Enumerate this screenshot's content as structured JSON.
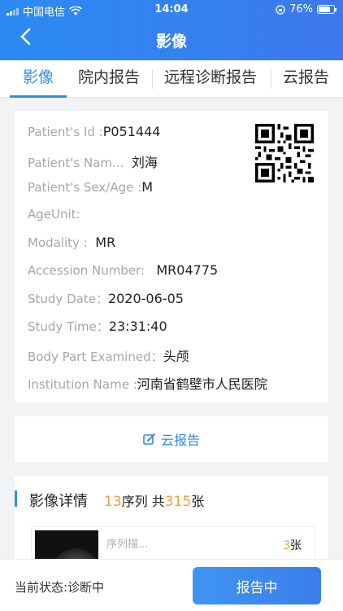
{
  "status_bar": {
    "carrier": "中国电信",
    "time": "14:04",
    "battery": "76%"
  },
  "nav": {
    "title": "影像",
    "back_icon": "chevron-left-icon"
  },
  "tabs": [
    {
      "label": "影像",
      "active": true
    },
    {
      "label": "院内报告",
      "active": false
    },
    {
      "label": "远程诊断报告",
      "active": false
    },
    {
      "label": "云报告",
      "active": false
    }
  ],
  "patient": {
    "id_label": "Patient's Id :",
    "id_value": "P051444",
    "name_label": "Patient's Nam...",
    "name_value": "刘海",
    "sex_label": "Patient's Sex/Age :",
    "sex_value": "M",
    "ageunit_label": "AgeUnit:",
    "modality_label": "Modality :",
    "modality_value": "MR",
    "accession_label": "Accession Number:",
    "accession_value": "MR04775",
    "study_date_label": "Study Date：",
    "study_date_value": "2020-06-05",
    "study_time_label": "Study Time：",
    "study_time_value": "23:31:40",
    "body_part_label": "Body Part Examined：",
    "body_part_value": "头颅",
    "institution_label": "Institution Name :",
    "institution_value": "河南省鹤壁市人民医院"
  },
  "cloud_report": {
    "label": "云报告",
    "icon": "edit-icon"
  },
  "image_detail": {
    "title": "影像详情",
    "series_count": "13",
    "series_unit": "序列 共",
    "image_count": "315",
    "image_unit": "张",
    "series": [
      {
        "label": "序列描...",
        "count": "3",
        "unit": "张"
      }
    ]
  },
  "footer": {
    "state": "当前状态:诊断中",
    "button": "报告中"
  },
  "colors": {
    "accent": "#2f8cf0",
    "highlight": "#f0a23a"
  }
}
